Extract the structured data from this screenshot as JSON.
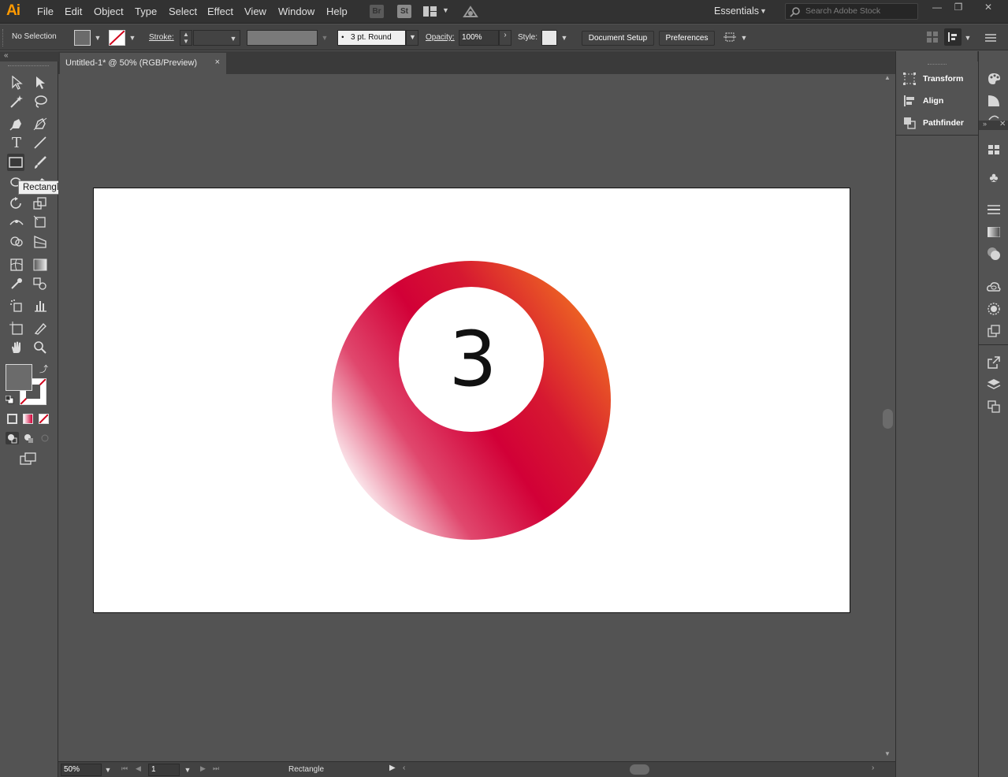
{
  "app": {
    "logo": "Ai"
  },
  "menu": [
    "File",
    "Edit",
    "Object",
    "Type",
    "Select",
    "Effect",
    "View",
    "Window",
    "Help"
  ],
  "bridge_label": "Br",
  "stock_label": "St",
  "workspace": "Essentials",
  "search": {
    "placeholder": "Search Adobe Stock"
  },
  "control": {
    "selection": "No Selection",
    "stroke_label": "Stroke:",
    "brush": "3 pt. Round",
    "opacity_label": "Opacity:",
    "opacity_value": "100%",
    "style_label": "Style:",
    "document_setup": "Document Setup",
    "preferences": "Preferences"
  },
  "document": {
    "tab_title": "Untitled-1* @ 50% (RGB/Preview)",
    "close": "×"
  },
  "tooltip": "Rectangle Tool (M)",
  "artwork": {
    "number": "3",
    "gradient_colors": [
      "#ffffff",
      "#e0476d",
      "#d20037",
      "#d61831",
      "#ef6a22"
    ]
  },
  "status": {
    "zoom": "50%",
    "artboard_number": "1",
    "current_tool": "Rectangle"
  },
  "panels": [
    {
      "icon": "transform-icon",
      "label": "Transform"
    },
    {
      "icon": "align-icon",
      "label": "Align"
    },
    {
      "icon": "pathfinder-icon",
      "label": "Pathfinder"
    }
  ],
  "colors": {
    "fill_swatch": "#6b6b6b",
    "stroke_none": "#d0021b",
    "accent": "#ff9a00"
  }
}
